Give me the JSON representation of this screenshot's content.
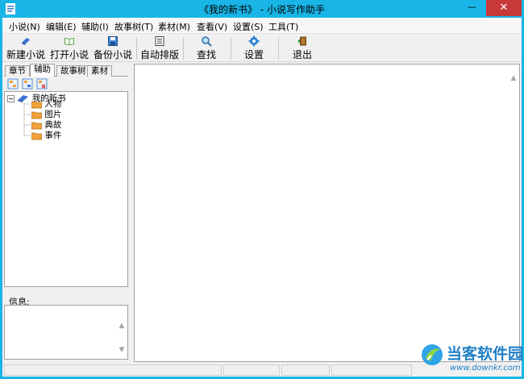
{
  "window": {
    "title": "《我的新书》 - 小说写作助手",
    "minimize_glyph": "—",
    "maximize_glyph": "☐",
    "close_glyph": "✕"
  },
  "menu": [
    "小说(N)",
    "编辑(E)",
    "辅助(I)",
    "故事树(T)",
    "素材(M)",
    "查看(V)",
    "设置(S)",
    "工具(T)"
  ],
  "toolbar": {
    "new_novel": "新建小说",
    "open_novel": "打开小说",
    "backup_novel": "备份小说",
    "auto_format": "自动排版",
    "find": "查找",
    "settings": "设置",
    "exit": "退出"
  },
  "left_panel": {
    "tabs": [
      "章节",
      "辅助",
      "故事树",
      "素材"
    ],
    "active_tab": "辅助",
    "tree": {
      "root": "我的新书",
      "children": [
        "人物",
        "图片",
        "典故",
        "事件"
      ]
    },
    "info_label": "信息:"
  },
  "watermark": {
    "brand": "当客软件园",
    "url": "www.downkr.com"
  },
  "colors": {
    "titlebar": "#19b5e6",
    "close_button": "#c7383a",
    "folder": "#f2a23a",
    "brand": "#1e7fc6"
  },
  "icons": {
    "new_novel": "book-blue-icon",
    "open_novel": "book-open-icon",
    "backup_novel": "disk-icon",
    "auto_format": "document-format-icon",
    "find": "magnifier-icon",
    "settings": "gear-icon",
    "exit": "exit-door-icon"
  }
}
